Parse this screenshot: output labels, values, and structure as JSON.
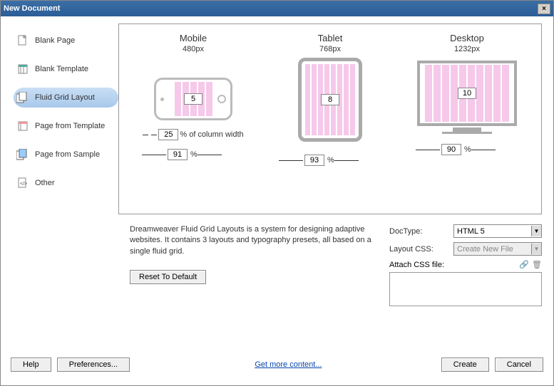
{
  "window": {
    "title": "New Document",
    "close": "×"
  },
  "sidebar": {
    "items": [
      {
        "label": "Blank Page"
      },
      {
        "label": "Blank Template"
      },
      {
        "label": "Fluid Grid Layout"
      },
      {
        "label": "Page from Template"
      },
      {
        "label": "Page from Sample"
      },
      {
        "label": "Other"
      }
    ]
  },
  "layout": {
    "mobile": {
      "title": "Mobile",
      "sub": "480px",
      "columns": "5",
      "col_pct": "25",
      "col_pct_label": "% of column width",
      "width_pct": "91"
    },
    "tablet": {
      "title": "Tablet",
      "sub": "768px",
      "columns": "8",
      "width_pct": "93"
    },
    "desktop": {
      "title": "Desktop",
      "sub": "1232px",
      "columns": "10",
      "width_pct": "90"
    },
    "pct_sym": "%"
  },
  "desc": {
    "text": "Dreamweaver Fluid Grid Layouts is a system for designing adaptive websites. It contains 3 layouts and typography presets, all based on a single fluid grid.",
    "reset": "Reset To Default"
  },
  "form": {
    "doctype_label": "DocType:",
    "doctype_value": "HTML 5",
    "layoutcss_label": "Layout CSS:",
    "layoutcss_value": "Create New File",
    "attach_label": "Attach CSS file:"
  },
  "footer": {
    "help": "Help",
    "prefs": "Preferences...",
    "link": "Get more content...",
    "create": "Create",
    "cancel": "Cancel"
  }
}
